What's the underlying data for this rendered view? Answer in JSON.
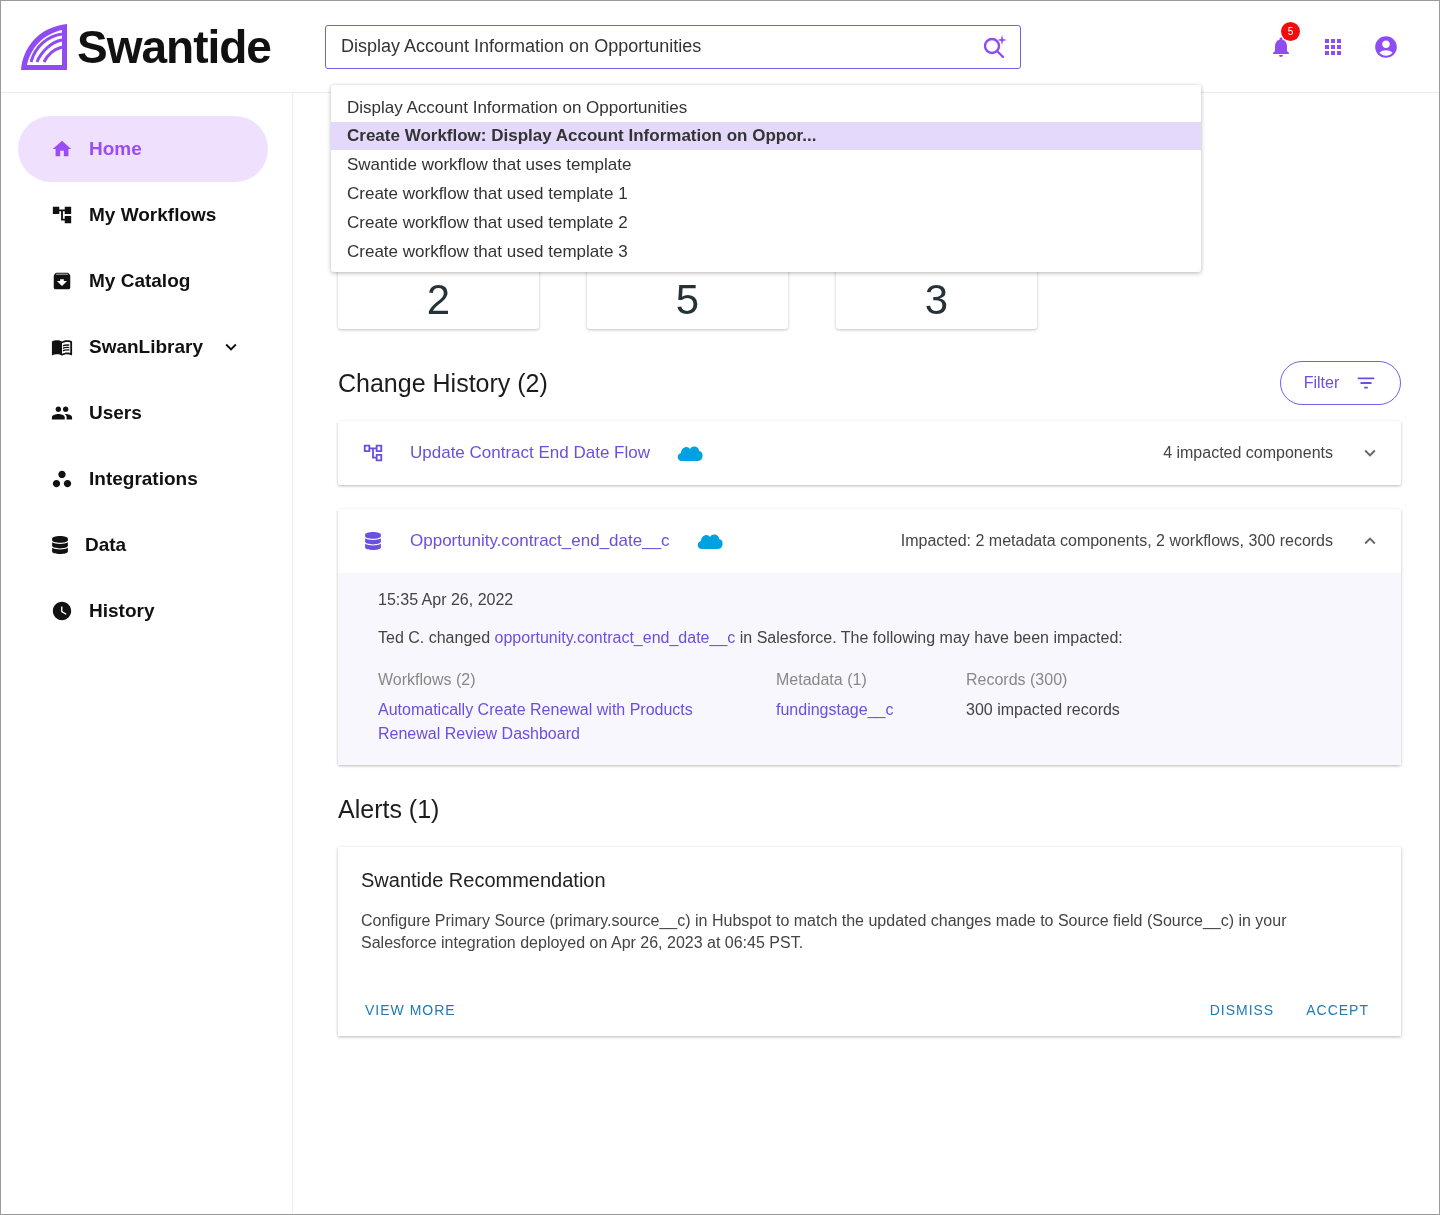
{
  "logo": {
    "text": "Swantide"
  },
  "search": {
    "value": "Display Account Information on Opportunities"
  },
  "notifications": {
    "count": "5"
  },
  "search_suggestions": [
    {
      "label": "Display Account Information on Opportunities",
      "selected": false
    },
    {
      "label": "Create Workflow: Display Account Information on Oppor...",
      "selected": true
    },
    {
      "label": "Swantide workflow that uses template",
      "selected": false
    },
    {
      "label": "Create workflow that used template 1",
      "selected": false
    },
    {
      "label": "Create workflow that used template 2",
      "selected": false
    },
    {
      "label": "Create workflow that used template 3",
      "selected": false
    }
  ],
  "sidebar": {
    "items": [
      {
        "label": "Home",
        "selected": true
      },
      {
        "label": "My Workflows",
        "selected": false
      },
      {
        "label": "My Catalog",
        "selected": false
      },
      {
        "label": "SwanLibrary",
        "selected": false,
        "expanded": false
      },
      {
        "label": "Users",
        "selected": false
      },
      {
        "label": "Integrations",
        "selected": false
      },
      {
        "label": "Data",
        "selected": false
      },
      {
        "label": "History",
        "selected": false
      }
    ]
  },
  "stats": [
    {
      "value": "2"
    },
    {
      "value": "5"
    },
    {
      "value": "3"
    }
  ],
  "change_history": {
    "title": "Change History (2)",
    "filter_button": "Filter",
    "items": [
      {
        "kind": "workflow",
        "title": "Update Contract End Date Flow",
        "summary": "4 impacted components",
        "expanded": false
      },
      {
        "kind": "field",
        "title": "Opportunity.contract_end_date__c",
        "summary": "Impacted: 2 metadata components, 2 workflows,  300 records",
        "expanded": true,
        "detail": {
          "time": "15:35  Apr 26, 2022",
          "message_before": "Ted C. changed",
          "message_link": "opportunity.contract_end_date__c",
          "message_after": "in Salesforce.  The following may have been impacted:",
          "columns": [
            {
              "heading": "Workflows (2)",
              "kind": "links",
              "items": [
                "Automatically Create Renewal with Products",
                "Renewal Review Dashboard"
              ]
            },
            {
              "heading": "Metadata (1)",
              "kind": "links",
              "items": [
                "fundingstage__c"
              ]
            },
            {
              "heading": "Records (300)",
              "kind": "text",
              "items": [
                "300 impacted records"
              ]
            }
          ]
        }
      }
    ]
  },
  "alerts": {
    "title": "Alerts (1)",
    "items": [
      {
        "title": "Swantide Recommendation",
        "body": "Configure Primary Source (primary.source__c) in Hubspot to match the updated changes made to Source field (Source__c) in your Salesforce integration deployed on Apr 26, 2023 at 06:45 PST.",
        "left_actions": [
          "VIEW MORE"
        ],
        "right_actions": [
          "DISMISS",
          "ACCEPT"
        ]
      }
    ]
  }
}
